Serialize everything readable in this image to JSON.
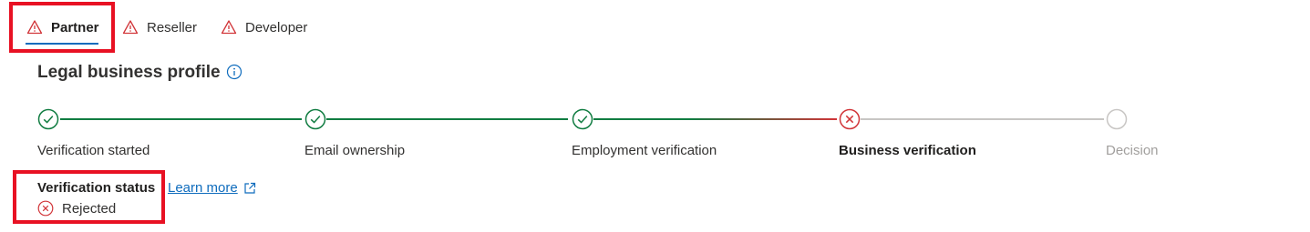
{
  "tabs": [
    {
      "label": "Partner",
      "icon": "warning-icon",
      "state": "active"
    },
    {
      "label": "Reseller",
      "icon": "warning-icon",
      "state": "inactive"
    },
    {
      "label": "Developer",
      "icon": "warning-icon",
      "state": "inactive"
    }
  ],
  "section": {
    "title": "Legal business profile",
    "info_icon": "info-icon"
  },
  "steps": [
    {
      "label": "Verification started",
      "status": "complete"
    },
    {
      "label": "Email ownership",
      "status": "complete"
    },
    {
      "label": "Employment verification",
      "status": "complete"
    },
    {
      "label": "Business verification",
      "status": "rejected"
    },
    {
      "label": "Decision",
      "status": "pending"
    }
  ],
  "status": {
    "title": "Verification status",
    "learn_more": "Learn more",
    "value": "Rejected",
    "value_icon": "error-circle-icon"
  },
  "colors": {
    "accent": "#0f6cbd",
    "success": "#107c41",
    "error": "#d13438",
    "pending": "#c8c6c4",
    "highlight": "#e81123"
  }
}
